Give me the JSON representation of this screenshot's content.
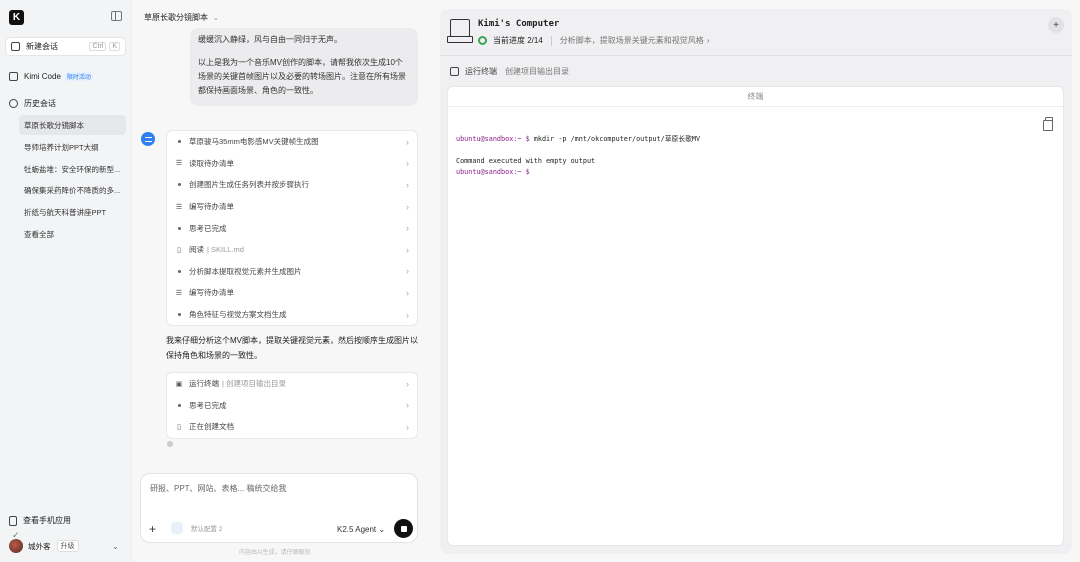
{
  "sidebar": {
    "logo": "K",
    "new_chat": {
      "label": "新建会话",
      "kbd": [
        "Ctrl",
        "K"
      ]
    },
    "kimi_code": {
      "label": "Kimi Code",
      "badge": "限时活动"
    },
    "history": {
      "label": "历史会话"
    },
    "history_items": [
      "草原长歌分镜脚本",
      "导师培养计划PPT大纲",
      "牡蛎盐堆：安全环保的新型...",
      "确保集采药降价不降质的多...",
      "折纸与航天科普讲座PPT",
      "查看全部"
    ],
    "phone_app": "查看手机应用",
    "user": {
      "name": "城外客",
      "upgrade": "升级"
    }
  },
  "chat": {
    "title": "草原长歌分镜脚本",
    "user_message": [
      "缓缓沉入静绿，风与自由一同归于无声。",
      "以上是我为一个音乐MV创作的脚本，请帮我依次生成10个场景的关键首帧图片以及必要的转场图片。注意在所有场景都保持画面场景、角色的一致性。"
    ],
    "steps_1": [
      {
        "icon": "dot",
        "label": "草原骏马35mm电影感MV关键帧生成图",
        "sub": ""
      },
      {
        "icon": "list",
        "label": "读取待办清单",
        "sub": ""
      },
      {
        "icon": "dot",
        "label": "创建图片生成任务列表并按步骤执行",
        "sub": ""
      },
      {
        "icon": "list",
        "label": "编写待办清单",
        "sub": ""
      },
      {
        "icon": "dot",
        "label": "思考已完成",
        "sub": ""
      },
      {
        "icon": "doc",
        "label": "阅读",
        "sub": "SKILL.md"
      },
      {
        "icon": "dot",
        "label": "分析脚本提取视觉元素并生成图片",
        "sub": ""
      },
      {
        "icon": "list",
        "label": "编写待办清单",
        "sub": ""
      },
      {
        "icon": "dot",
        "label": "角色特征与视觉方案文档生成",
        "sub": ""
      }
    ],
    "reply": "我来仔细分析这个MV脚本，提取关键视觉元素，然后按顺序生成图片以保持角色和场景的一致性。",
    "steps_2": [
      {
        "icon": "term",
        "label": "运行终端",
        "sub": "创建项目输出目录"
      },
      {
        "icon": "dot",
        "label": "思考已完成",
        "sub": ""
      },
      {
        "icon": "doc",
        "label": "正在创建文档",
        "sub": ""
      }
    ],
    "composer": {
      "placeholder": "研报、PPT、网站、表格... 稿统交给我",
      "skill": "默认配置 2",
      "agent": "K2.5 Agent ⌄"
    },
    "disclaimer": "内容由AI生成，请仔细甄别"
  },
  "computer": {
    "title": "Kimi's Computer",
    "progress": "当前进度 2/14",
    "progress_note": "分析脚本，提取场景关键元素和视觉风格",
    "tool": {
      "label": "运行终端",
      "sub": "创建项目输出目录"
    },
    "terminal": {
      "tab": "终端",
      "lines": [
        {
          "prompt": "ubuntu@sandbox:~ $",
          "text": " mkdir -p /mnt/okcomputer/output/草原长歌MV"
        },
        {
          "prompt": "",
          "text": ""
        },
        {
          "prompt": "",
          "text": "Command executed with empty output"
        },
        {
          "prompt": "ubuntu@sandbox:~ $",
          "text": ""
        }
      ]
    }
  },
  "colors": {
    "accent": "#2f80ed",
    "progress": "#3aa655",
    "prompt": "#8a1d8a"
  }
}
